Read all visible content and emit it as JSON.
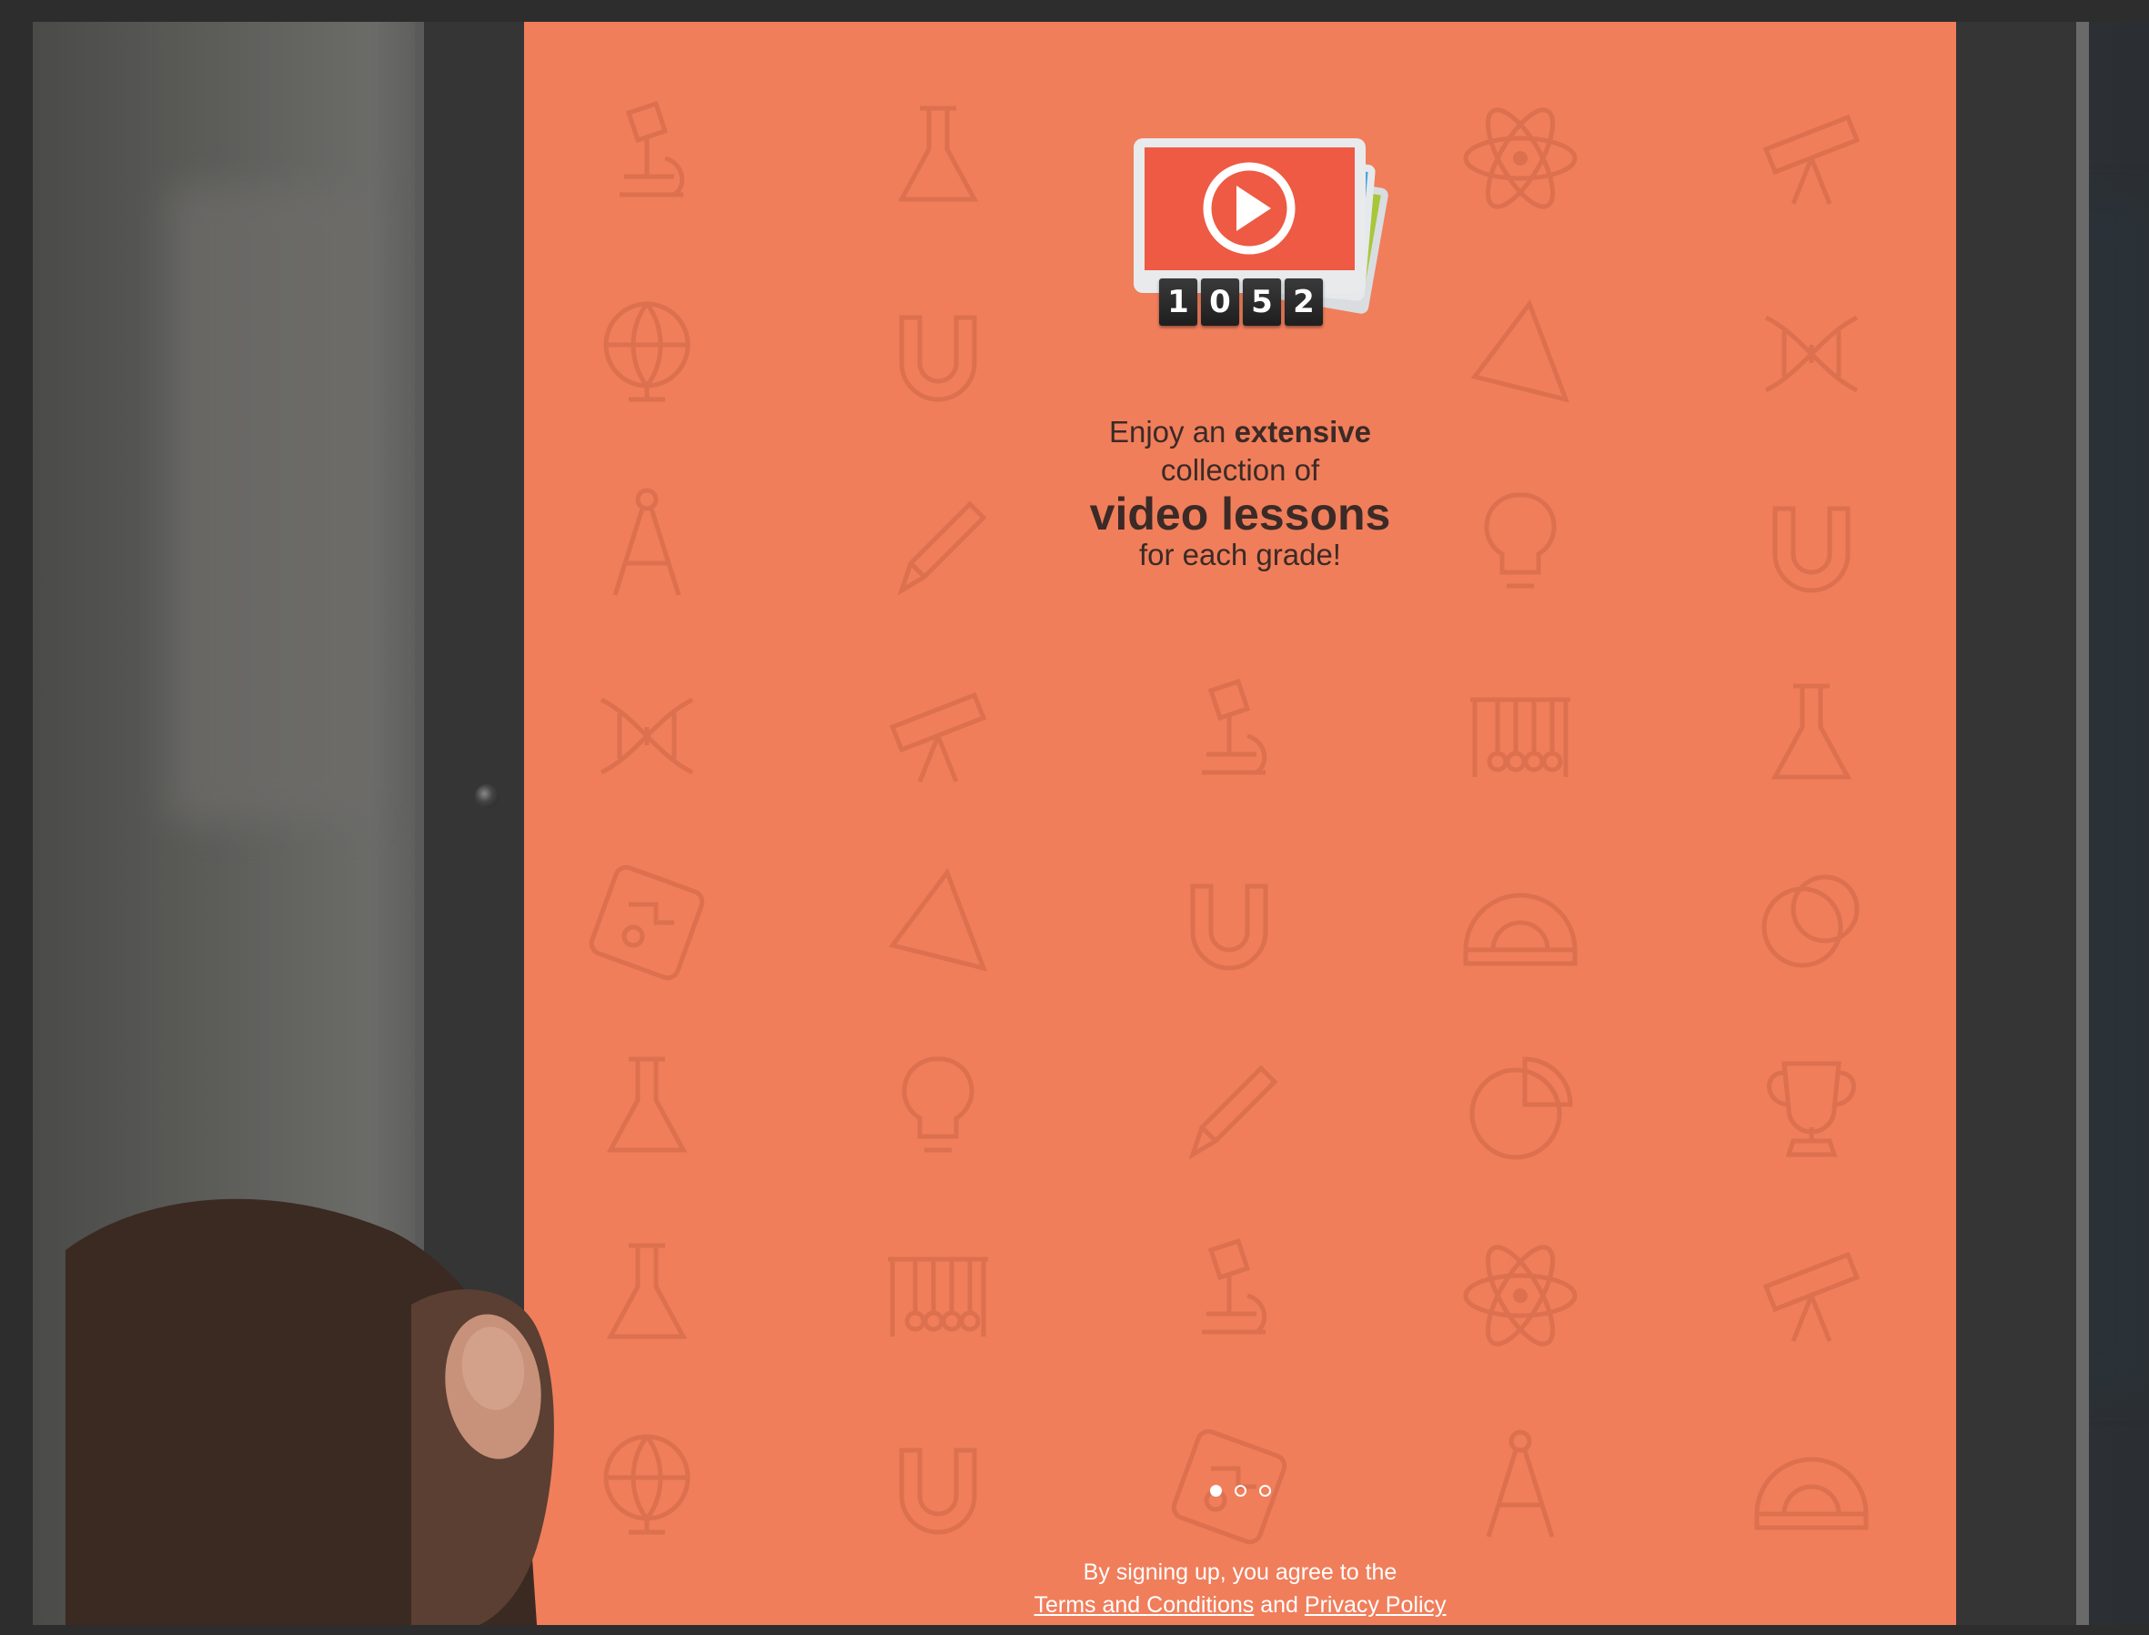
{
  "promo": {
    "counter_digits": [
      "1",
      "0",
      "5",
      "2"
    ],
    "headline": {
      "line1_prefix": "Enjoy an ",
      "line1_bold": "extensive",
      "line2": "collection of",
      "line3": "video lessons",
      "line4": "for each grade!"
    },
    "pager": {
      "total": 3,
      "active_index": 0
    },
    "legal": {
      "prefix": "By signing up, you agree to the",
      "terms_link": "Terms and Conditions",
      "joiner": " and ",
      "privacy_link": "Privacy Policy"
    }
  },
  "colors": {
    "screen_background": "#f07e5b",
    "pattern_icons": "#d66c4c",
    "play_card": "#ee5a43",
    "text_dark": "#3b2a26"
  },
  "icons": {
    "logo": "video-play-cards-icon",
    "pattern": [
      "microscope-icon",
      "flask-icon",
      "atom-icon",
      "telescope-icon",
      "globe-icon",
      "magnet-icon",
      "triangle-icon",
      "dna-icon",
      "compass-icon",
      "pencil-icon",
      "lightbulb-icon",
      "newtons-cradle-icon",
      "protractor-icon",
      "trophy-icon",
      "pie-chart-icon",
      "venn-icon",
      "circuit-board-icon"
    ]
  }
}
